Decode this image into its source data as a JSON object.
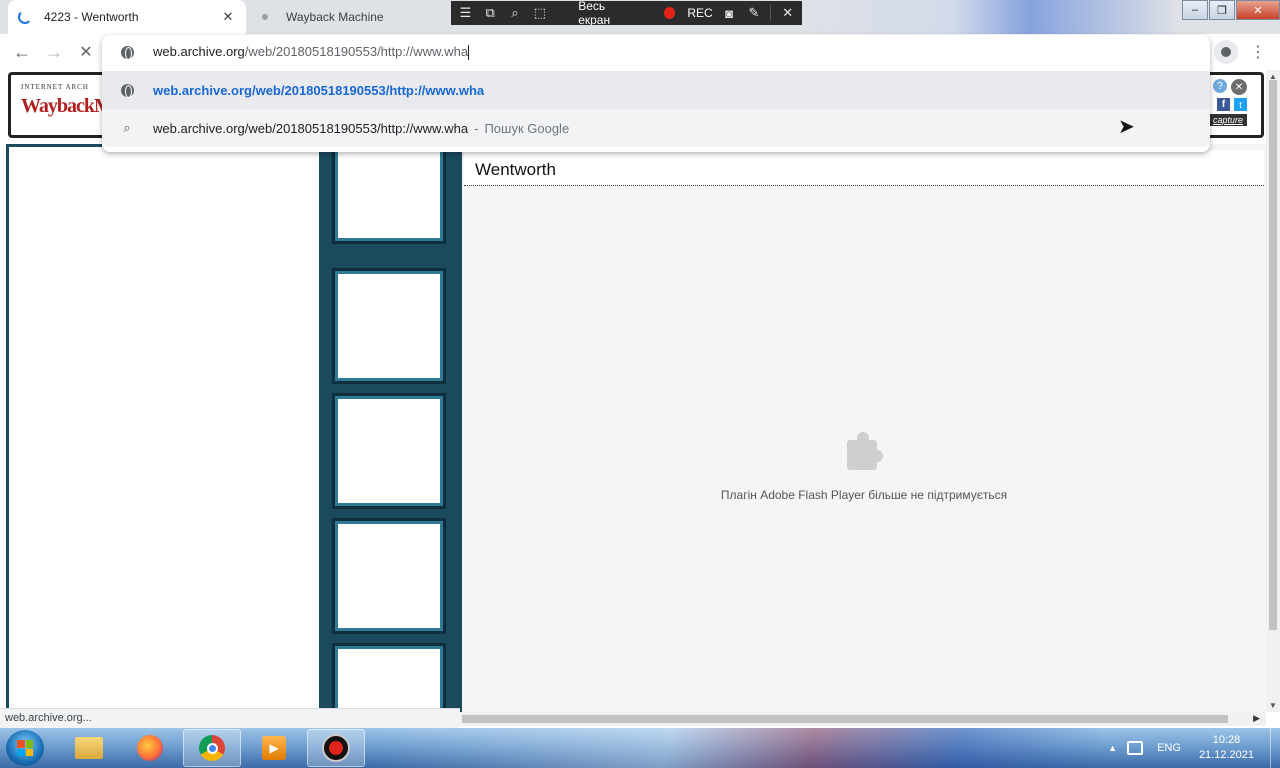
{
  "tabs": [
    {
      "title": "4223 - Wentworth",
      "close": "✕"
    },
    {
      "title": "Wayback Machine"
    }
  ],
  "recorder": {
    "mode_label": "Весь екран",
    "rec_label": "REC"
  },
  "window_controls": {
    "minimize": "–",
    "maximize": "❐",
    "close": "✕"
  },
  "nav": {
    "back": "←",
    "forward": "→",
    "stop": "✕"
  },
  "omnibox": {
    "host": "web.archive.org",
    "path": "/web/20180518190553/http://www.wha",
    "suggestions": [
      {
        "text": "web.archive.org/web/20180518190553/http://www.wha",
        "type": "url"
      },
      {
        "text": "web.archive.org/web/20180518190553/http://www.wha",
        "separator": "-",
        "hint": "Пошук Google",
        "type": "search"
      }
    ]
  },
  "wayback": {
    "small_title": "INTERNET ARCH",
    "logo": "WaybackMach",
    "help": "?",
    "close": "✕",
    "facebook": "f",
    "twitter": "t",
    "capture": "capture"
  },
  "content": {
    "title": "Wentworth",
    "plugin_message": "Плагін Adobe Flash Player більше не підтримується"
  },
  "status_url": "web.archive.org...",
  "taskbar": {
    "lang": "ENG",
    "time": "10:28",
    "date": "21.12.2021"
  },
  "icons": {
    "tab_loading": "spinner-icon",
    "globe": "globe-icon",
    "search": "search-icon",
    "puzzle": "puzzle-icon"
  },
  "colors": {
    "link_blue": "#1967d2",
    "frame_teal": "#1a4a5c",
    "rec_red": "#e2231a"
  }
}
